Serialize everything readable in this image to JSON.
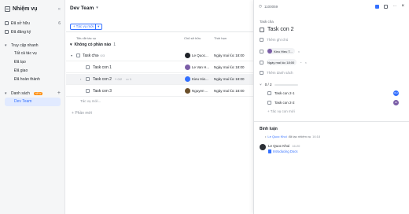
{
  "sidebar": {
    "title": "Nhiệm vụ",
    "items": [
      {
        "label": "Đã sở hữu",
        "count": "6"
      },
      {
        "label": "Đã đăng ký",
        "count": ""
      }
    ],
    "quick_access": {
      "label": "Truy cập nhanh",
      "items": [
        "Tất cả tác vụ",
        "Đã tạo",
        "Đã giao",
        "Đã hoàn thành"
      ]
    },
    "lists": {
      "label": "Danh sách",
      "badge": "NEW",
      "items": [
        "Dev Team"
      ]
    }
  },
  "main": {
    "project_title": "Dev Team",
    "new_task_label": "Tác vụ mới",
    "columns": [
      "Tiêu đề tác vụ",
      "Chủ sở hữu",
      "Thời hạn"
    ],
    "group": {
      "label": "Không có phần nào",
      "count": "1"
    },
    "tasks": [
      {
        "name": "Task cha",
        "meta": "0/3",
        "owner": "Le Quoc...",
        "due": "Ngày mai lúc 18:00",
        "avatar_color": "#1f2329"
      },
      {
        "name": "Task con 1",
        "meta": "",
        "owner": "Le Van H...",
        "due": "Ngày mai lúc 18:00",
        "avatar_color": "#7b5ea7"
      },
      {
        "name": "Task con 2",
        "meta": "0/2",
        "meta2": "1",
        "owner": "Kieu Hie...",
        "due": "Ngày mai lúc 18:00",
        "avatar_color": "#3370ff"
      },
      {
        "name": "Task con 3",
        "meta": "",
        "owner": "Nguyen ...",
        "due": "Ngày mai lúc 18:00",
        "avatar_color": "#6b4f2a"
      }
    ],
    "add_task_label": "Tác vụ mới...",
    "add_section_label": "Phần mới"
  },
  "panel": {
    "task_id": "1100059",
    "parent_label": "Task cha",
    "title": "Task con 2",
    "add_note": "Thêm ghi chú",
    "assignee": "Kieu Hieu T...",
    "due": "Ngày mai lúc 18:00",
    "add_list": "Thêm danh sách",
    "subtask_progress": "0 / 2",
    "subtasks": [
      {
        "name": "Task con 2-1",
        "avatar_color": "#3370ff",
        "initials": "KH"
      },
      {
        "name": "Task con 2-2",
        "avatar_color": "#7b5ea7",
        "initials": "LV"
      }
    ],
    "add_subtask": "Tác vụ con mới",
    "comments_title": "Bình luận",
    "activity": {
      "user": "Le Quoc Khoi",
      "text": "đã tạo nhiệm vụ",
      "time": "16:18"
    },
    "comment": {
      "user": "Le Quoc Khoi",
      "time": "16:20",
      "link": "Introducing Docs"
    }
  },
  "colors": {
    "accent": "#3370ff",
    "sidebar_bg": "#f5f6f7",
    "active_bg": "#e1eaff"
  }
}
